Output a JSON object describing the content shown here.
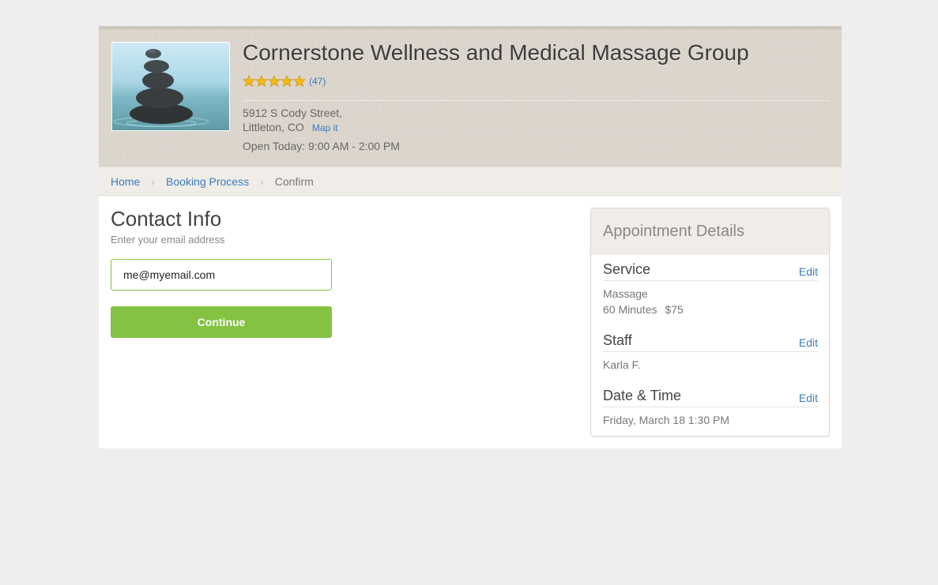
{
  "business": {
    "name": "Cornerstone Wellness and Medical Massage Group",
    "rating": 5,
    "review_count": "(47)",
    "address_line1": "5912 S Cody Street,",
    "address_line2": "Littleton, CO",
    "map_link": "Map it",
    "hours": "Open Today: 9:00 AM - 2:00 PM"
  },
  "breadcrumb": {
    "home": "Home",
    "booking": "Booking Process",
    "current": "Confirm",
    "separator": "›"
  },
  "contact": {
    "title": "Contact Info",
    "subtitle": "Enter your email address",
    "email_value": "me@myemail.com",
    "continue_label": "Continue"
  },
  "appointment": {
    "title": "Appointment Details",
    "service": {
      "heading": "Service",
      "edit": "Edit",
      "name": "Massage",
      "duration": "60 Minutes",
      "price": "$75"
    },
    "staff": {
      "heading": "Staff",
      "edit": "Edit",
      "name": "Karla F."
    },
    "datetime": {
      "heading": "Date & Time",
      "edit": "Edit",
      "value": "Friday, March 18 1:30 PM"
    }
  },
  "colors": {
    "accent_green": "#84c341",
    "link_blue": "#3a7bbf",
    "star_gold": "#f5b914"
  },
  "icons": [
    "star-icon",
    "chevron-right-icon",
    "stacked-stones-logo"
  ]
}
